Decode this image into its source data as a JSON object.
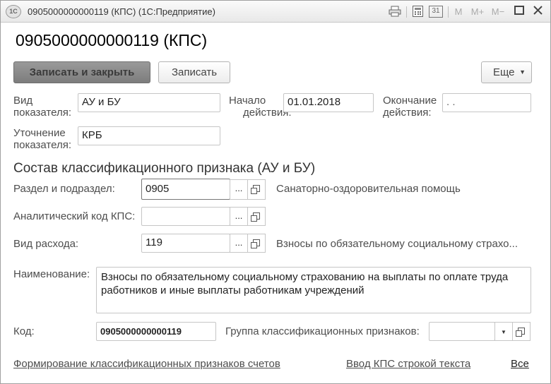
{
  "window": {
    "logo": "1С",
    "title": "0905000000000119 (КПС)  (1С:Предприятие)",
    "tools": {
      "m": "M",
      "m_plus": "M+",
      "m_minus": "M−",
      "calendar": "31"
    }
  },
  "header": {
    "title": "0905000000000119 (КПС)"
  },
  "toolbar": {
    "save_close": "Записать и закрыть",
    "save": "Записать",
    "more": "Еще"
  },
  "fields": {
    "indicator_type_label_1": "Вид",
    "indicator_type_label_2": "показателя:",
    "indicator_type_value": "АУ и БУ",
    "start_label_1": "Начало",
    "start_label_2": "действия:",
    "start_value": "01.01.2018",
    "end_label_1": "Окончание",
    "end_label_2": "действия:",
    "end_value": " .  .",
    "refine_label_1": "Уточнение",
    "refine_label_2": "показателя:",
    "refine_value": "КРБ"
  },
  "section": {
    "title": "Состав классификационного признака (АУ и БУ)"
  },
  "classification": {
    "section_label": "Раздел и подраздел:",
    "section_value": "0905",
    "section_desc": "Санаторно-оздоровительная помощь",
    "analytic_label": "Аналитический код КПС:",
    "analytic_value": "",
    "expense_label": "Вид расхода:",
    "expense_value": "119",
    "expense_desc": "Взносы по обязательному социальному страхо...",
    "select_glyph": "...",
    "name_label": "Наименование:",
    "name_line1": "Взносы по обязательному социальному страхованию на выплаты по оплате труда",
    "name_line2": "работников и иные выплаты работникам учреждений",
    "code_label": "Код:",
    "code_value": "0905000000000119",
    "group_label": "Группа классификационных признаков:",
    "group_value": ""
  },
  "footer": {
    "link_forming": "Формирование классификационных признаков счетов",
    "link_input": "Ввод КПС строкой текста",
    "link_all": "Все"
  }
}
